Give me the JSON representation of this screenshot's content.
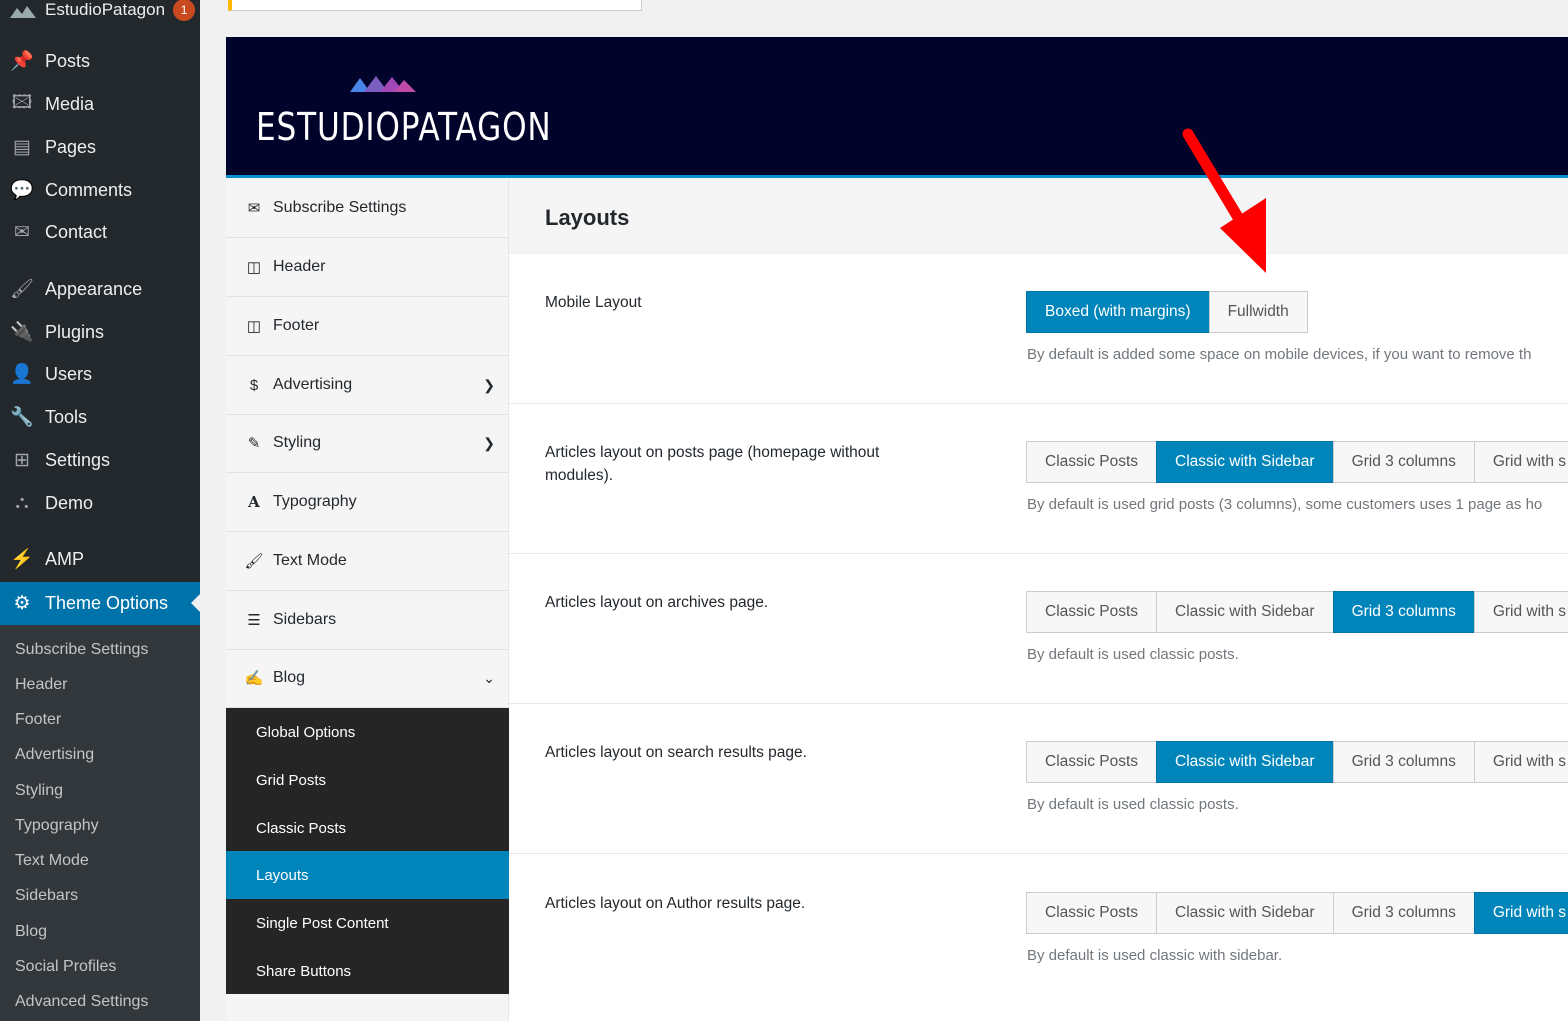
{
  "admin_bar": {
    "site_name": "EstudioPatagon",
    "notifications": "1"
  },
  "wp_menu": {
    "items": [
      {
        "label": "Posts",
        "icon": "pushpin-icon"
      },
      {
        "label": "Media",
        "icon": "media-icon"
      },
      {
        "label": "Pages",
        "icon": "pages-icon"
      },
      {
        "label": "Comments",
        "icon": "comment-icon"
      },
      {
        "label": "Contact",
        "icon": "mail-icon"
      },
      {
        "label": "Appearance",
        "icon": "brush-icon"
      },
      {
        "label": "Plugins",
        "icon": "plug-icon"
      },
      {
        "label": "Users",
        "icon": "user-icon"
      },
      {
        "label": "Tools",
        "icon": "wrench-icon"
      },
      {
        "label": "Settings",
        "icon": "settings-icon"
      },
      {
        "label": "Demo",
        "icon": "sitemap-icon"
      },
      {
        "label": "AMP",
        "icon": "bolt-icon"
      },
      {
        "label": "Theme Options",
        "icon": "gear-icon"
      }
    ],
    "submenu": [
      "Subscribe Settings",
      "Header",
      "Footer",
      "Advertising",
      "Styling",
      "Typography",
      "Text Mode",
      "Sidebars",
      "Blog",
      "Social Profiles",
      "Advanced Settings"
    ]
  },
  "banner": {
    "brand": "ESTUDIOPATAGON"
  },
  "options_nav": {
    "items": [
      {
        "label": "Subscribe Settings",
        "icon": "envelope-icon"
      },
      {
        "label": "Header",
        "icon": "columns-icon"
      },
      {
        "label": "Footer",
        "icon": "columns-icon"
      },
      {
        "label": "Advertising",
        "icon": "dollar-icon"
      },
      {
        "label": "Styling",
        "icon": "pencil-icon"
      },
      {
        "label": "Typography",
        "icon": "font-icon"
      },
      {
        "label": "Text Mode",
        "icon": "paintbrush-icon"
      },
      {
        "label": "Sidebars",
        "icon": "list-icon"
      },
      {
        "label": "Blog",
        "icon": "edit-icon"
      }
    ],
    "blog_sub": [
      "Global Options",
      "Grid Posts",
      "Classic Posts",
      "Layouts",
      "Single Post Content",
      "Share Buttons"
    ]
  },
  "content": {
    "title": "Layouts",
    "rows": [
      {
        "label": "Mobile Layout",
        "buttons": [
          "Boxed (with margins)",
          "Fullwidth"
        ],
        "desc": "By default is added some space on mobile devices, if you want to remove th"
      },
      {
        "label": "Articles layout on posts page (homepage without modules).",
        "buttons": [
          "Classic Posts",
          "Classic with Sidebar",
          "Grid 3 columns",
          "Grid with s"
        ],
        "desc": "By default is used grid posts (3 columns), some customers uses 1 page as ho"
      },
      {
        "label": "Articles layout on archives page.",
        "buttons": [
          "Classic Posts",
          "Classic with Sidebar",
          "Grid 3 columns",
          "Grid with s"
        ],
        "desc": "By default is used classic posts."
      },
      {
        "label": "Articles layout on search results page.",
        "buttons": [
          "Classic Posts",
          "Classic with Sidebar",
          "Grid 3 columns",
          "Grid with s"
        ],
        "desc": "By default is used classic posts."
      },
      {
        "label": "Articles layout on Author results page.",
        "buttons": [
          "Classic Posts",
          "Classic with Sidebar",
          "Grid 3 columns",
          "Grid with s"
        ],
        "desc": "By default is used classic with sidebar."
      }
    ]
  },
  "colors": {
    "accent": "#0085ba",
    "wp_sidebar": "#23282d",
    "banner": "#02032b",
    "annotation_arrow": "#ff0000"
  }
}
